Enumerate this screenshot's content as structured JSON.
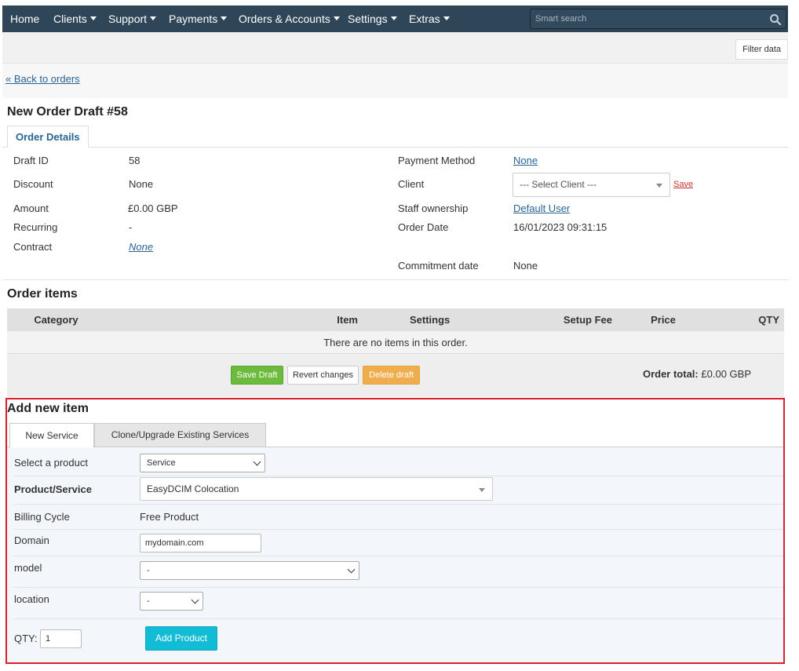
{
  "nav": {
    "items": [
      {
        "label": "Home",
        "caret": false
      },
      {
        "label": "Clients",
        "caret": true
      },
      {
        "label": "Support",
        "caret": true
      },
      {
        "label": "Payments",
        "caret": true
      },
      {
        "label": "Orders & Accounts",
        "caret": true
      },
      {
        "label": "Settings",
        "caret": true
      },
      {
        "label": "Extras",
        "caret": true
      }
    ],
    "search_placeholder": "Smart search"
  },
  "toolbar": {
    "filter_label": "Filter data"
  },
  "back_link": "« Back to orders",
  "page_title": "New Order Draft #58",
  "details_tab": "Order Details",
  "details": {
    "draft_id": {
      "label": "Draft ID",
      "value": "58"
    },
    "discount": {
      "label": "Discount",
      "value": "None"
    },
    "amount": {
      "label": "Amount",
      "value": "£0.00 GBP"
    },
    "recurring": {
      "label": "Recurring",
      "value": "-"
    },
    "contract": {
      "label": "Contract",
      "value": "None"
    },
    "payment_method": {
      "label": "Payment Method",
      "value": "None"
    },
    "client": {
      "label": "Client",
      "select_value": "--- Select Client ---",
      "save_label": "Save"
    },
    "staff_ownership": {
      "label": "Staff ownership",
      "value": "Default User"
    },
    "order_date": {
      "label": "Order Date",
      "value": "16/01/2023 09:31:15"
    },
    "commitment_date": {
      "label": "Commitment date",
      "value": "None"
    }
  },
  "order_items": {
    "title": "Order items",
    "columns": [
      "Category",
      "Item",
      "Settings",
      "Setup Fee",
      "Price",
      "QTY"
    ],
    "empty_text": "There are no items in this order.",
    "save_draft": "Save Draft",
    "revert": "Revert changes",
    "delete_draft": "Delete draft",
    "total_label": "Order total:",
    "total_value": "£0.00 GBP"
  },
  "add_item": {
    "title": "Add new item",
    "tabs": [
      "New Service",
      "Clone/Upgrade Existing Services"
    ],
    "select_product": {
      "label": "Select a product",
      "value": "Service"
    },
    "product_service": {
      "label": "Product/Service",
      "value": "EasyDCIM Colocation"
    },
    "billing_cycle": {
      "label": "Billing Cycle",
      "value": "Free Product"
    },
    "domain": {
      "label": "Domain",
      "value": "mydomain.com"
    },
    "model": {
      "label": "model",
      "value": "-"
    },
    "location": {
      "label": "location",
      "value": "-"
    },
    "qty": {
      "label": "QTY:",
      "value": "1"
    },
    "add_button": "Add Product"
  },
  "colors": {
    "nav_bg": "#2f4659",
    "link": "#2a6496",
    "save_draft": "#6cbb3c",
    "delete_draft": "#f0ad4e",
    "add_product": "#12bcd4",
    "highlight": "#d81f2b"
  }
}
